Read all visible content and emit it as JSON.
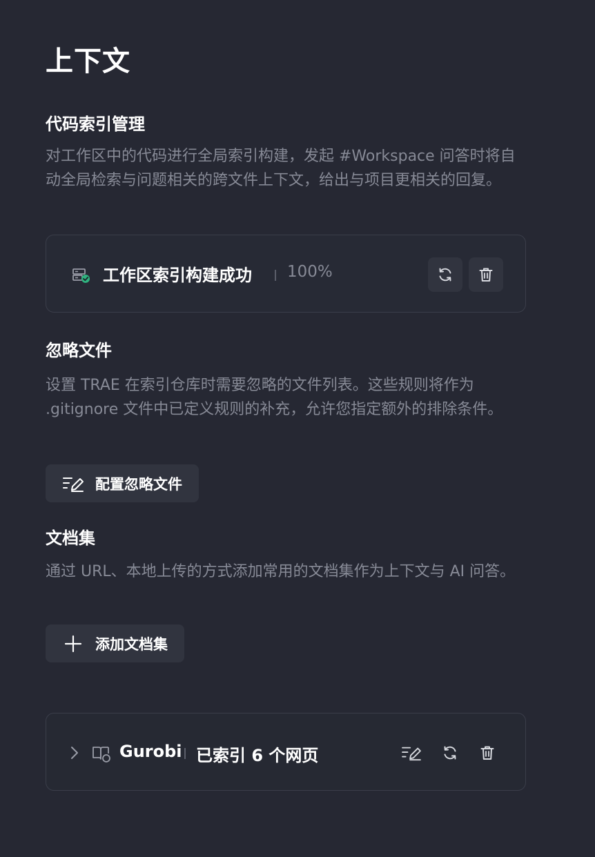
{
  "page": {
    "title": "上下文"
  },
  "code_index": {
    "title": "代码索引管理",
    "description": "对工作区中的代码进行全局索引构建，发起 #Workspace 问答时将自动全局检索与问题相关的跨文件上下文，给出与项目更相关的回复。",
    "status_icon": "server-check-icon",
    "status_label": "工作区索引构建成功",
    "progress_text": "100%",
    "progress": 100,
    "status_color": "#2fb27f",
    "refresh_icon": "refresh-icon",
    "delete_icon": "trash-icon"
  },
  "ignore_files": {
    "title": "忽略文件",
    "description": "设置 TRAE 在索引仓库时需要忽略的文件列表。这些规则将作为 .gitignore 文件中已定义规则的补充，允许您指定额外的排除条件。",
    "button_label": "配置忽略文件",
    "button_icon": "edit-list-icon"
  },
  "doc_sets": {
    "title": "文档集",
    "description": "通过 URL、本地上传的方式添加常用的文档集作为上下文与 AI 问答。",
    "button_label": "添加文档集",
    "button_icon": "plus-icon",
    "items": [
      {
        "name": "Gurobi",
        "status": "已索引 6 个网页",
        "expand_icon": "chevron-right-icon",
        "doc_icon": "book-icon",
        "actions": [
          "edit-list-icon",
          "refresh-icon",
          "trash-icon"
        ]
      }
    ]
  }
}
